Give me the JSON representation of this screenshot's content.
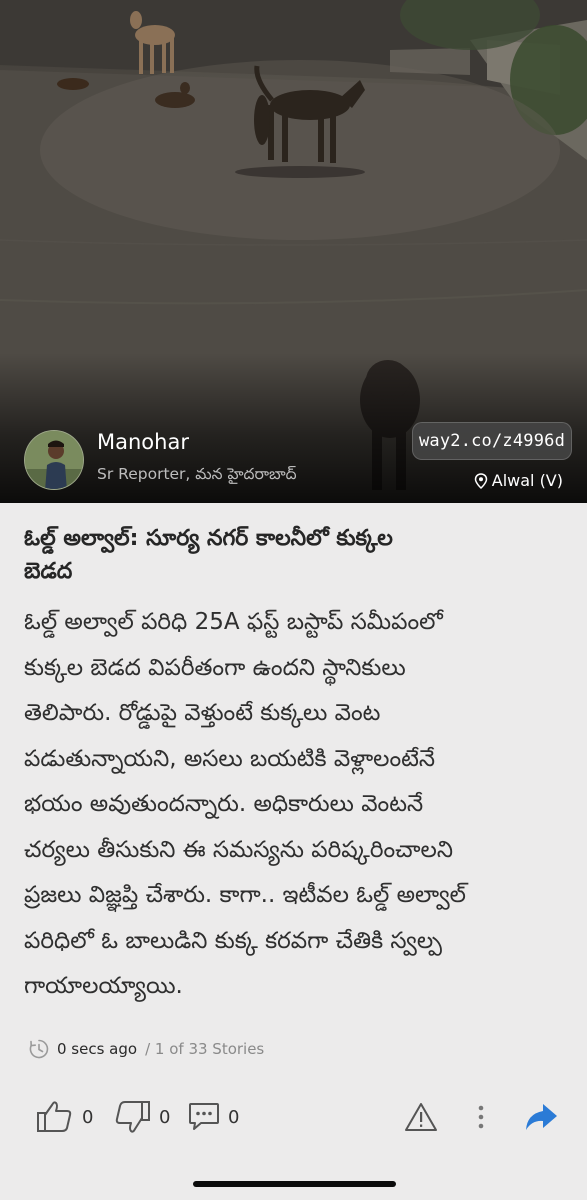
{
  "author": {
    "name": "Manohar",
    "role": "Sr Reporter, మన హైదరాబాద్",
    "avatar": "reporter-avatar-photo"
  },
  "short_link": "way2.co/z4996d",
  "location": "Alwal (V)",
  "article": {
    "headline_lines": [
      "ఓల్డ్ అల్వాల్: సూర్య నగర్ కాలనీలో కుక్కల",
      "బెడద"
    ],
    "body_lines": [
      "ఓల్డ్ అల్వాల్ పరిధి 25A ఫస్ట్ బస్టాప్ సమీపంలో",
      "కుక్కల బెడద విపరీతంగా ఉందని స్థానికులు",
      "తెలిపారు. రోడ్డుపై వెళ్తుంటే కుక్కలు వెంట",
      "పడుతున్నాయని, అసలు బయటికి వెళ్లాలంటేనే",
      "భయం అవుతుందన్నారు. అధికారులు వెంటనే",
      "చర్యలు తీసుకుని ఈ సమస్యను పరిష్కరించాలని",
      "ప్రజలు విజ్ఞప్తి చేశారు. కాగా.. ఇటీవల ఓల్డ్ అల్వాల్",
      "పరిధిలో ఓ బాలుడిని కుక్క కరవగా చేతికి స్వల్ప",
      "గాయాలయ్యాయి."
    ]
  },
  "meta": {
    "time": "0 secs ago",
    "story_position": "/ 1 of 33 Stories"
  },
  "actions": {
    "likes": "0",
    "dislikes": "0",
    "comments": "0"
  },
  "icons": {
    "clock": "clock-icon",
    "like": "thumbs-up-icon",
    "dislike": "thumbs-down-icon",
    "comment": "comment-icon",
    "report": "warning-icon",
    "more": "more-vertical-icon",
    "share": "share-icon",
    "location": "location-pin-icon"
  },
  "colors": {
    "background": "#ecebeb",
    "text": "#2f2f2f",
    "share_accent": "#2b7bd6",
    "icon_gray": "#555555"
  }
}
